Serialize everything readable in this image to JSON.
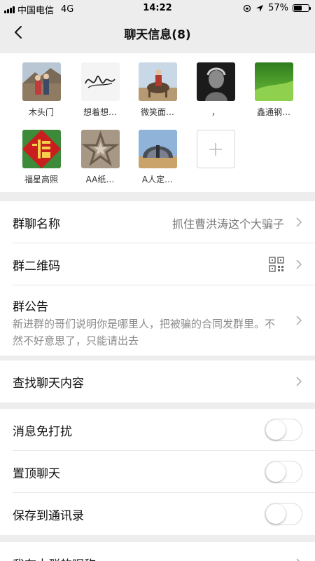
{
  "status_bar": {
    "carrier": "中国电信",
    "network": "4G",
    "time": "14:22",
    "battery_text": "57%",
    "battery_level": 0.57
  },
  "nav": {
    "title": "聊天信息(8)"
  },
  "members": [
    {
      "name": "木头门",
      "avatar": "photo-great-wall"
    },
    {
      "name": "想着想…",
      "avatar": "signature-image"
    },
    {
      "name": "微笑面…",
      "avatar": "photo-horse-rider"
    },
    {
      "name": "，",
      "avatar": "photo-dark-portrait"
    },
    {
      "name": "鑫通钢…",
      "avatar": "photo-green-field"
    },
    {
      "name": "福星高照",
      "avatar": "fu-character"
    },
    {
      "name": "AA纸…",
      "avatar": "star-emblem"
    },
    {
      "name": "A人定…",
      "avatar": "photo-building"
    }
  ],
  "settings": {
    "group_name_label": "群聊名称",
    "group_name_value": "抓住曹洪涛这个大骗子",
    "qr_code_label": "群二维码",
    "announcement_label": "群公告",
    "announcement_text": "新进群的哥们说明你是哪里人，把被骗的合同发群里。不然不好意思了，只能请出去",
    "search_label": "查找聊天内容",
    "mute_label": "消息免打扰",
    "mute_on": false,
    "pin_label": "置顶聊天",
    "pin_on": false,
    "save_contacts_label": "保存到通讯录",
    "save_contacts_on": false,
    "nickname_label": "我在本群的昵称"
  },
  "colors": {
    "background": "#ededed",
    "cell": "#ffffff",
    "secondary_text": "#8a8a8a"
  }
}
